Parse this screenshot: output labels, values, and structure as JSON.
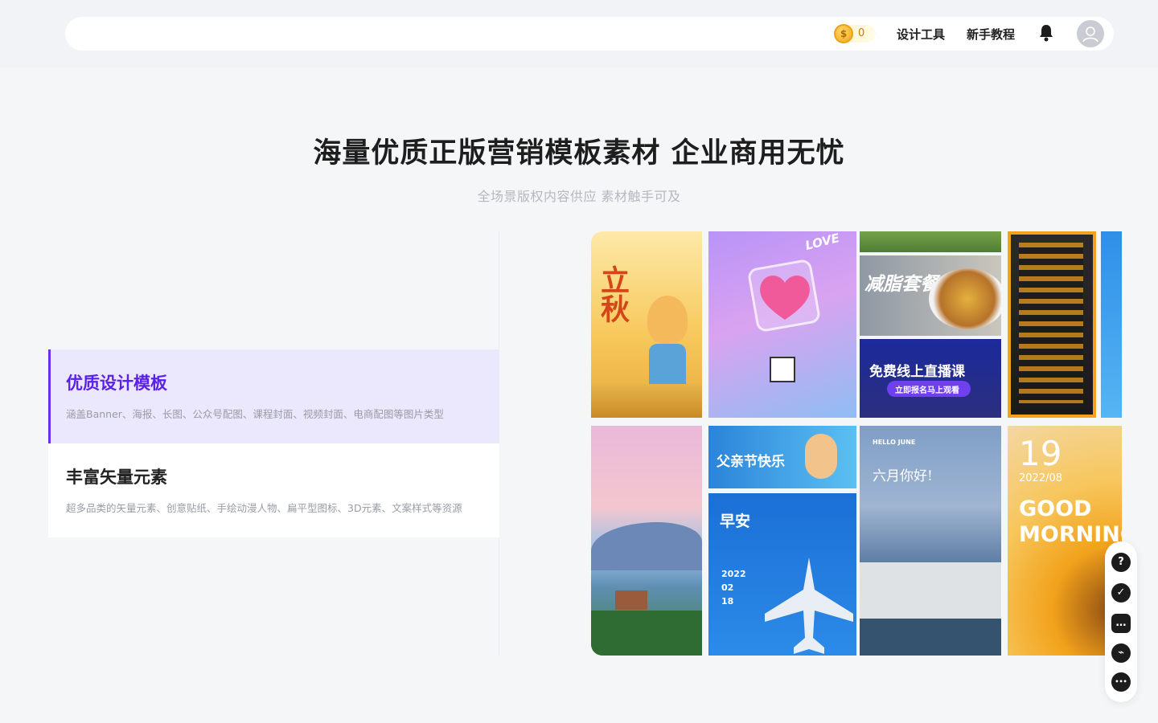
{
  "header": {
    "coin_count": "0",
    "coin_symbol": "$",
    "nav": [
      "设计工具",
      "新手教程"
    ]
  },
  "hero": {
    "title": "海量优质正版营销模板素材 企业商用无忧",
    "subtitle": "全场景版权内容供应 素材触手可及"
  },
  "features": [
    {
      "title": "优质设计模板",
      "desc": "涵盖Banner、海报、长图、公众号配图、课程封面、视频封面、电商配图等图片类型"
    },
    {
      "title": "丰富矢量元素",
      "desc": "超多品类的矢量元素、创意贴纸、手绘动漫人物、扁平型图标、3D元素、文案样式等资源"
    }
  ],
  "gallery": {
    "tiles": [
      {
        "name": "autumn-poster",
        "text": "立秋"
      },
      {
        "name": "love-poster",
        "text": "LOVE"
      },
      {
        "name": "diet-poster",
        "text": "减脂套餐"
      },
      {
        "name": "live-course-poster",
        "text": "免费线上直播课",
        "sub": "立即报名马上观看"
      },
      {
        "name": "fathers-day-poster",
        "text": "父亲节快乐"
      },
      {
        "name": "morning-flight-poster",
        "text": "早安",
        "sub": "2022\n02\n18"
      },
      {
        "name": "june-poster",
        "text": "六月你好!",
        "sub": "HELLO JUNE"
      },
      {
        "name": "good-morning-poster",
        "text": "GOOD",
        "text2": "MORNING",
        "num": "19",
        "sub": "2022/08"
      }
    ]
  },
  "sidetools": {
    "icons": [
      "help-icon",
      "check-icon",
      "message-icon",
      "link-icon",
      "chat-icon"
    ],
    "glyphs": [
      "?",
      "✓",
      "…",
      "⌁",
      "•••"
    ]
  },
  "colors": {
    "accent": "#6b2cf5",
    "active_bg": "#ebe7fd"
  }
}
